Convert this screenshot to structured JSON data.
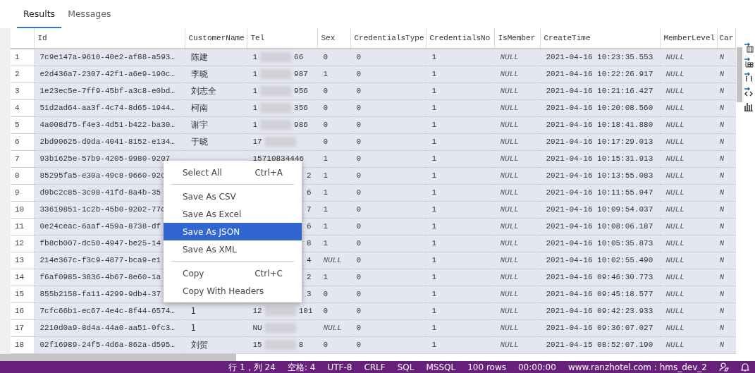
{
  "tabs": [
    {
      "label": "Results",
      "selected": true
    },
    {
      "label": "Messages",
      "selected": false
    }
  ],
  "grid": {
    "columns": [
      "Id",
      "CustomerName",
      "Tel",
      "Sex",
      "CredentialsType",
      "CredentialsNo",
      "IsMember",
      "CreateTime",
      "MemberLevel",
      "Car"
    ],
    "rows": [
      {
        "number": "1",
        "cells": [
          "7c9e147a-9610-40e2-af88-a593…",
          "陈建",
          {
            "kind": "blurred",
            "start": "1",
            "end": "66"
          },
          "0",
          "0",
          "1",
          {
            "text": "NULL",
            "null": true
          },
          "2021-04-16 10:23:35.553",
          {
            "text": "NULL",
            "null": true
          },
          {
            "text": "N",
            "null": true
          }
        ]
      },
      {
        "number": "2",
        "cells": [
          "e2d436a7-2307-42f1-a6e9-190c…",
          "李晓",
          {
            "kind": "blurred",
            "start": "1",
            "end": "987"
          },
          "1",
          "0",
          "1",
          {
            "text": "NULL",
            "null": true
          },
          "2021-04-16 10:22:26.917",
          {
            "text": "NULL",
            "null": true
          },
          {
            "text": "N",
            "null": true
          }
        ]
      },
      {
        "number": "3",
        "cells": [
          "1e23ec5e-7ff9-45bf-a3c8-e0bd…",
          "刘志全",
          {
            "kind": "blurred",
            "start": "1",
            "end": "956"
          },
          "0",
          "0",
          "1",
          {
            "text": "NULL",
            "null": true
          },
          "2021-04-16 10:21:16.427",
          {
            "text": "NULL",
            "null": true
          },
          {
            "text": "N",
            "null": true
          }
        ]
      },
      {
        "number": "4",
        "cells": [
          "51d2ad64-aa3f-4c74-8d65-1944…",
          "柯南",
          {
            "kind": "blurred",
            "start": "1",
            "end": "356"
          },
          "0",
          "0",
          "1",
          {
            "text": "NULL",
            "null": true
          },
          "2021-04-16 10:20:08.560",
          {
            "text": "NULL",
            "null": true
          },
          {
            "text": "N",
            "null": true
          }
        ]
      },
      {
        "number": "5",
        "cells": [
          "4a008d75-f4e3-4d51-b422-ba30…",
          "谢宇",
          {
            "kind": "blurred",
            "start": "1",
            "end": "986"
          },
          "0",
          "0",
          "1",
          {
            "text": "NULL",
            "null": true
          },
          "2021-04-16 10:18:41.880",
          {
            "text": "NULL",
            "null": true
          },
          {
            "text": "N",
            "null": true
          }
        ]
      },
      {
        "number": "6",
        "cells": [
          "2bd90625-d9da-4041-8152-e134…",
          "于晓",
          {
            "kind": "blurred",
            "start": "17"
          },
          "0",
          "0",
          "1",
          {
            "text": "NULL",
            "null": true
          },
          "2021-04-16 10:17:29.013",
          {
            "text": "NULL",
            "null": true
          },
          {
            "text": "N",
            "null": true
          }
        ]
      },
      {
        "number": "7",
        "cells": [
          "93b1625e-57b9-4205-9980-9207",
          "",
          {
            "kind": "full",
            "text": "15710834446"
          },
          "1",
          "0",
          "1",
          {
            "text": "NULL",
            "null": true
          },
          "2021-04-16 10:15:31.913",
          {
            "text": "NULL",
            "null": true
          },
          {
            "text": "N",
            "null": true
          }
        ]
      },
      {
        "number": "8",
        "cells": [
          "85295fa5-e30a-49c8-9660-92c",
          "",
          {
            "kind": "partial",
            "text": "2"
          },
          "1",
          "0",
          "1",
          {
            "text": "NULL",
            "null": true
          },
          "2021-04-16 10:13:55.083",
          {
            "text": "NULL",
            "null": true
          },
          {
            "text": "N",
            "null": true
          }
        ]
      },
      {
        "number": "9",
        "cells": [
          "d9bc2c85-3c98-41fd-8a4b-35",
          "",
          {
            "kind": "partial",
            "text": "6"
          },
          "1",
          "0",
          "1",
          {
            "text": "NULL",
            "null": true
          },
          "2021-04-16 10:11:55.947",
          {
            "text": "NULL",
            "null": true
          },
          {
            "text": "N",
            "null": true
          }
        ]
      },
      {
        "number": "10",
        "cells": [
          "33619851-1c2b-45b0-9202-77c",
          "",
          {
            "kind": "partial",
            "text": "7"
          },
          "1",
          "0",
          "1",
          {
            "text": "NULL",
            "null": true
          },
          "2021-04-16 10:09:54.037",
          {
            "text": "NULL",
            "null": true
          },
          {
            "text": "N",
            "null": true
          }
        ]
      },
      {
        "number": "11",
        "cells": [
          "0e24ceac-6aaf-459a-8738-df",
          "",
          {
            "kind": "partial",
            "text": "6"
          },
          "1",
          "0",
          "1",
          {
            "text": "NULL",
            "null": true
          },
          "2021-04-16 10:08:06.187",
          {
            "text": "NULL",
            "null": true
          },
          {
            "text": "N",
            "null": true
          }
        ]
      },
      {
        "number": "12",
        "cells": [
          "fb8cb007-dc50-4947-be25-14",
          "",
          {
            "kind": "partial",
            "text": "8"
          },
          "1",
          "0",
          "1",
          {
            "text": "NULL",
            "null": true
          },
          "2021-04-16 10:05:35.873",
          {
            "text": "NULL",
            "null": true
          },
          {
            "text": "N",
            "null": true
          }
        ]
      },
      {
        "number": "13",
        "cells": [
          "214e367c-f3c9-4877-bca9-e1",
          "",
          {
            "kind": "partial",
            "text": "4"
          },
          {
            "text": "NULL",
            "null": true
          },
          "0",
          "1",
          {
            "text": "NULL",
            "null": true
          },
          "2021-04-16 10:02:55.490",
          {
            "text": "NULL",
            "null": true
          },
          {
            "text": "N",
            "null": true
          }
        ]
      },
      {
        "number": "14",
        "cells": [
          "f6af0985-3836-4b67-8e60-1a",
          "",
          {
            "kind": "partial",
            "text": "2"
          },
          "1",
          "0",
          "1",
          {
            "text": "NULL",
            "null": true
          },
          "2021-04-16 09:46:30.773",
          {
            "text": "NULL",
            "null": true
          },
          {
            "text": "N",
            "null": true
          }
        ]
      },
      {
        "number": "15",
        "cells": [
          "855b2158-fa11-4299-9db4-37",
          "",
          {
            "kind": "partial",
            "text": "3"
          },
          "0",
          "0",
          "1",
          {
            "text": "NULL",
            "null": true
          },
          "2021-04-16 09:45:18.577",
          {
            "text": "NULL",
            "null": true
          },
          {
            "text": "N",
            "null": true
          }
        ]
      },
      {
        "number": "16",
        "cells": [
          "7cfc66b1-ec67-4e4c-8f44-6574…",
          "1",
          {
            "kind": "blurred",
            "start": "12",
            "end": "101"
          },
          "0",
          "0",
          "1",
          {
            "text": "NULL",
            "null": true
          },
          "2021-04-16 09:42:23.933",
          {
            "text": "NULL",
            "null": true
          },
          {
            "text": "N",
            "null": true
          }
        ]
      },
      {
        "number": "17",
        "cells": [
          "2210d0a9-8d4a-44a0-aa51-0fc3…",
          "1",
          {
            "kind": "blurred",
            "start": "NU"
          },
          {
            "text": "NULL",
            "null": true
          },
          "0",
          "1",
          {
            "text": "NULL",
            "null": true
          },
          "2021-04-16 09:36:07.027",
          {
            "text": "NULL",
            "null": true
          },
          {
            "text": "N",
            "null": true
          }
        ]
      },
      {
        "number": "18",
        "cells": [
          "02f16989-24f5-4d6a-862a-d595…",
          "刘贺",
          {
            "kind": "blurred",
            "start": "15",
            "end": "8"
          },
          "0",
          "0",
          "1",
          {
            "text": "NULL",
            "null": true
          },
          "2021-04-15 08:52:07.190",
          {
            "text": "NULL",
            "null": true
          },
          {
            "text": "N",
            "null": true
          }
        ]
      }
    ]
  },
  "context_menu": {
    "groups": [
      [
        {
          "label": "Select All",
          "shortcut": "Ctrl+A",
          "selected": false
        }
      ],
      [
        {
          "label": "Save As CSV",
          "selected": false
        },
        {
          "label": "Save As Excel",
          "selected": false
        },
        {
          "label": "Save As JSON",
          "selected": true
        },
        {
          "label": "Save As XML",
          "selected": false
        }
      ],
      [
        {
          "label": "Copy",
          "shortcut": "Ctrl+C",
          "selected": false
        },
        {
          "label": "Copy With Headers",
          "selected": false
        }
      ]
    ]
  },
  "status_bar": {
    "items": [
      "行 1，列 24",
      "空格: 4",
      "UTF-8",
      "CRLF",
      "SQL",
      "MSSQL",
      "100 rows",
      "00:00:00",
      "www.ranzhotel.com : hms_dev_2"
    ]
  }
}
